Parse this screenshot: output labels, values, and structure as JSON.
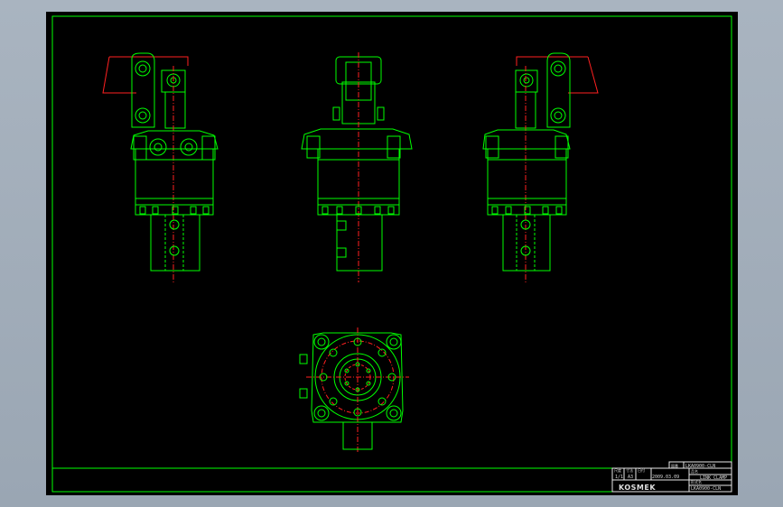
{
  "title_block": {
    "drawing_number_top": "LKA0900-CLN",
    "drawing_number_top_label": "図番",
    "name_label": "品名",
    "name": "LINK CLAMP",
    "scale_label": "尺度",
    "scale": "1/1",
    "size_label": "寸法",
    "size": "A3",
    "date_label": "日付",
    "date": "2009.03.09",
    "model_label": "形式名",
    "model": "LKA0900-CLN",
    "logo": "KOSMEK"
  },
  "colors": {
    "background": "#000000",
    "outline": "#00ff00",
    "centerline": "#ff2020",
    "frame_text": "#d8d8d8",
    "window_chrome": "#a9b4c0"
  }
}
